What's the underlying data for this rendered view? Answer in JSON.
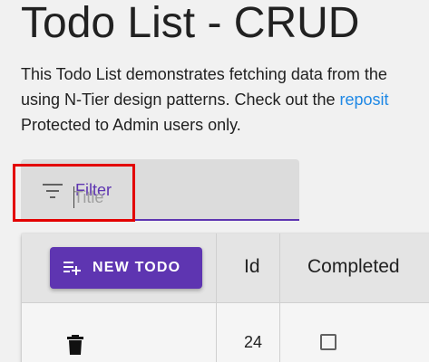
{
  "page": {
    "title": "Todo List - CRUD",
    "intro": {
      "line1": "This Todo List demonstrates fetching data from the",
      "line2_prefix": "using N-Tier design patterns. Check out the ",
      "line2_link": "reposit",
      "line3": "Protected to Admin users only."
    }
  },
  "filter": {
    "label": "Filter",
    "placeholder": "Title",
    "icon": "filter-list-icon"
  },
  "table": {
    "new_button": {
      "label": "NEW TODO",
      "icon": "playlist-add-icon"
    },
    "headers": {
      "id": "Id",
      "completed": "Completed"
    },
    "rows": [
      {
        "id": "24",
        "completed": false,
        "action_icon": "delete-icon"
      }
    ]
  },
  "colors": {
    "accent": "#5e35b1",
    "link": "#1e88e5",
    "highlight": "#e30000"
  }
}
